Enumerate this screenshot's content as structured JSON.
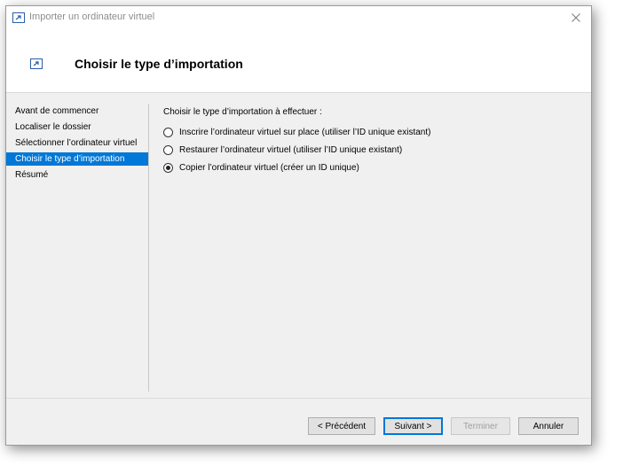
{
  "window": {
    "title": "Importer un ordinateur virtuel",
    "close_glyph": "✕"
  },
  "header": {
    "title": "Choisir le type d’importation",
    "icon": "wizard-arrow-icon"
  },
  "sidebar": {
    "items": [
      {
        "label": "Avant de commencer",
        "active": false
      },
      {
        "label": "Localiser le dossier",
        "active": false
      },
      {
        "label": "Sélectionner l’ordinateur virtuel",
        "active": false
      },
      {
        "label": "Choisir le type d’importation",
        "active": true
      },
      {
        "label": "Résumé",
        "active": false
      }
    ]
  },
  "main": {
    "prompt": "Choisir le type d’importation à effectuer :",
    "options": [
      {
        "label": "Inscrire l’ordinateur virtuel sur place (utiliser l’ID unique existant)",
        "checked": false
      },
      {
        "label": "Restaurer l’ordinateur virtuel (utiliser l’ID unique existant)",
        "checked": false
      },
      {
        "label": "Copier l’ordinateur virtuel (créer un ID unique)",
        "checked": true
      }
    ]
  },
  "footer": {
    "previous_label": "< Précédent",
    "next_label": "Suivant >",
    "finish_label": "Terminer",
    "cancel_label": "Annuler"
  },
  "colors": {
    "accent": "#0078d7",
    "icon_blue": "#2a5ea8"
  }
}
